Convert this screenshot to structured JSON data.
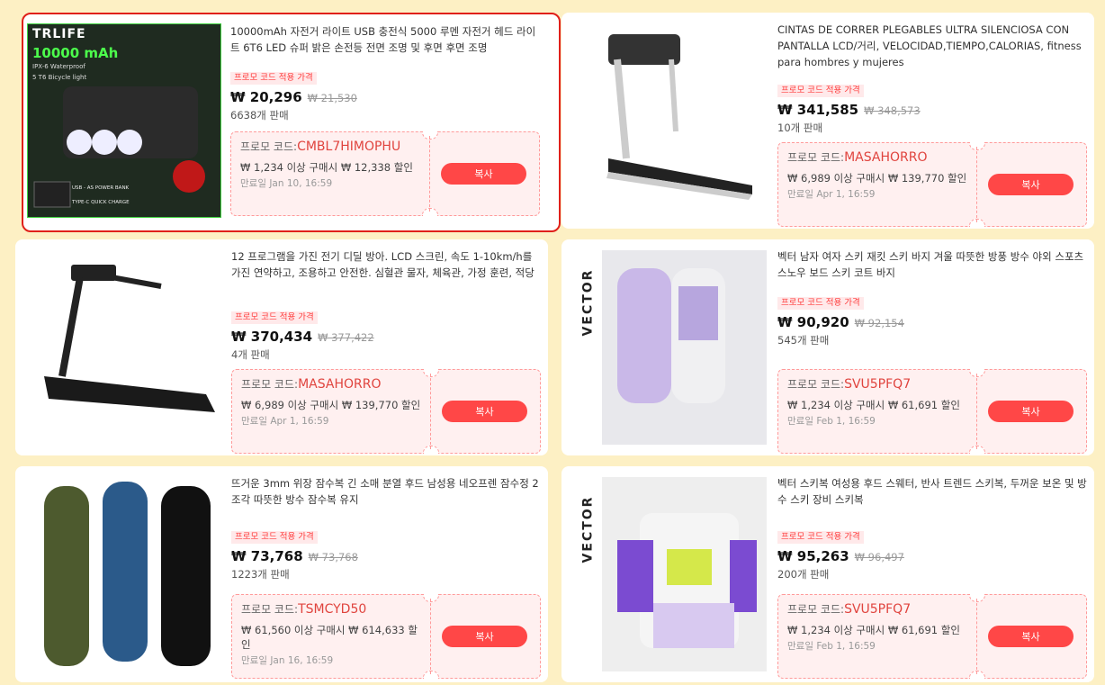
{
  "labels": {
    "badge": "프로모 코드 적용 가격",
    "code_prefix": "프로모 코드:",
    "copy": "복사"
  },
  "products": [
    {
      "title": "10000mAh 자전거 라이트 USB 충전식 5000 루멘 자전거 헤드 라이트 6T6 LED 슈퍼 밝은 손전등 전면 조명 및 후면 후면 조명",
      "price": "₩ 20,296",
      "orig": "₩ 21,530",
      "sold": "6638개 판매",
      "code": "CMBL7HIMOPHU",
      "cond": "₩ 1,234 이상 구매시 ₩ 12,338 할인",
      "exp": "만료일 Jan 10, 16:59",
      "img_text": [
        "TRLIFE",
        "10000 mAh",
        "IPX-6 Waterproof",
        "5 T6 Bicycle light",
        "USB - AS POWER BANK",
        "TYPE-C QUICK CHARGE"
      ]
    },
    {
      "title": "CINTAS DE CORRER PLEGABLES ULTRA SILENCIOSA CON PANTALLA LCD/거리, VELOCIDAD,TIEMPO,CALORIAS, fitness para hombres y mujeres",
      "price": "₩ 341,585",
      "orig": "₩ 348,573",
      "sold": "10개 판매",
      "code": "MASAHORRO",
      "cond": "₩ 6,989 이상 구매시 ₩ 139,770 할인",
      "exp": "만료일 Apr 1, 16:59"
    },
    {
      "title": "12 프로그램을 가진 전기 디딜 방아. LCD 스크린, 속도 1-10km/h를 가진 연약하고, 조용하고 안전한. 심혈관 물자, 체육관, 가정 훈련, 적당",
      "price": "₩ 370,434",
      "orig": "₩ 377,422",
      "sold": "4개 판매",
      "code": "MASAHORRO",
      "cond": "₩ 6,989 이상 구매시 ₩ 139,770 할인",
      "exp": "만료일 Apr 1, 16:59"
    },
    {
      "title": "벡터 남자 여자 스키 재킷 스키 바지 겨울 따뜻한 방풍 방수 야외 스포츠 스노우 보드 스키 코트 바지",
      "price": "₩ 90,920",
      "orig": "₩ 92,154",
      "sold": "545개 판매",
      "code": "SVU5PFQ7",
      "cond": "₩ 1,234 이상 구매시 ₩ 61,691 할인",
      "exp": "만료일 Feb 1, 16:59",
      "img_text": [
        "VECTOR"
      ]
    },
    {
      "title": "뜨거운 3mm 위장 잠수복 긴 소매 분열 후드 남성용 네오프렌 잠수정 2 조각 따뜻한 방수 잠수복 유지",
      "price": "₩ 73,768",
      "orig": "₩ 73,768",
      "sold": "1223개 판매",
      "code": "TSMCYD50",
      "cond": "₩ 61,560 이상 구매시 ₩ 614,633 할인",
      "exp": "만료일 Jan 16, 16:59"
    },
    {
      "title": "벡터 스키복 여성용 후드 스웨터, 반사 트렌드 스키복, 두꺼운 보온 및 방수 스키 장비 스키복",
      "price": "₩ 95,263",
      "orig": "₩ 96,497",
      "sold": "200개 판매",
      "code": "SVU5PFQ7",
      "cond": "₩ 1,234 이상 구매시 ₩ 61,691 할인",
      "exp": "만료일 Feb 1, 16:59",
      "img_text": [
        "VECTOR"
      ]
    }
  ],
  "colors": {
    "accent": "#ff4747",
    "background": "#fdf0c4",
    "selection": "#e0201a"
  }
}
